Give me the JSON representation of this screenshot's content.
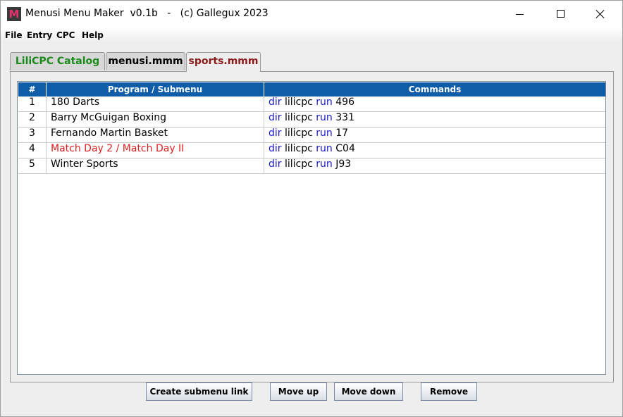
{
  "window": {
    "title": "Menusi Menu Maker  v0.1b   -   (c) Gallegux 2023",
    "icon_letter": "M"
  },
  "menubar": {
    "items": [
      "File",
      "Entry",
      "CPC",
      "Help"
    ]
  },
  "tabs": [
    {
      "label": "LiliCPC Catalog",
      "color": "#1a8a1a",
      "active": false
    },
    {
      "label": "menusi.mmm",
      "color": "#000000",
      "active": false
    },
    {
      "label": "sports.mmm",
      "color": "#8b1a1a",
      "active": true
    }
  ],
  "table": {
    "columns": [
      "#",
      "Program / Submenu",
      "Commands"
    ],
    "header_color": "#0f5ca8",
    "rows": [
      {
        "num": "1",
        "program": "180 Darts",
        "cmd": {
          "dir": "dir",
          "src": "lilicpc",
          "run": "run",
          "arg": "496"
        }
      },
      {
        "num": "2",
        "program": "Barry McGuigan Boxing",
        "cmd": {
          "dir": "dir",
          "src": "lilicpc",
          "run": "run",
          "arg": "331"
        }
      },
      {
        "num": "3",
        "program": "Fernando Martin Basket",
        "cmd": {
          "dir": "dir",
          "src": "lilicpc",
          "run": "run",
          "arg": "17"
        }
      },
      {
        "num": "4",
        "program": "Match Day 2 / Match Day II",
        "submenu": true,
        "cmd": {
          "dir": "dir",
          "src": "lilicpc",
          "run": "run",
          "arg": "C04"
        }
      },
      {
        "num": "5",
        "program": "Winter Sports",
        "cmd": {
          "dir": "dir",
          "src": "lilicpc",
          "run": "run",
          "arg": "J93"
        }
      }
    ]
  },
  "buttons": {
    "create_submenu_link": "Create submenu link",
    "move_up": "Move up",
    "move_down": "Move down",
    "remove": "Remove"
  }
}
